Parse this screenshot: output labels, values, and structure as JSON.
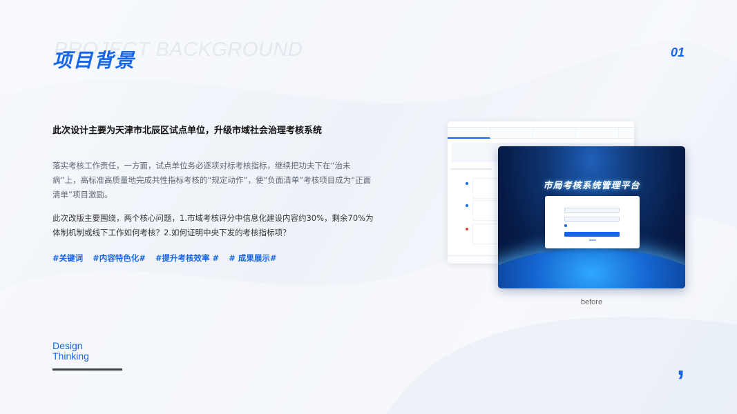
{
  "header": {
    "watermark": "PROJECT  BACKGROUND",
    "title": "项目背景",
    "page_number": "01"
  },
  "content": {
    "subtitle": "此次设计主要为天津市北辰区试点单位，升级市域社会治理考核系统",
    "paragraph1": "落实考核工作责任，一方面，试点单位务必逐项对标考核指标，继续把功夫下在“治未病”上，高标准高质量地完成共性指标考核的“规定动作”，使“负面清单”考核项目成为“正面清单”项目激励。",
    "paragraph2": "此次改版主要围绕，两个核心问题，1.市域考核评分中信息化建设内容约30%，剩余70%为体制机制或线下工作如何考核？2.如何证明中央下发的考核指标项？",
    "tags": [
      "#关键词",
      "#内容特色化#",
      "#提升考核效率 #",
      "# 成果展示#"
    ]
  },
  "footer": {
    "design_line1": "Design",
    "design_line2": "Thinking",
    "comma": ","
  },
  "screenshot": {
    "login_title": "市局考核系统管理平台",
    "caption": "before"
  },
  "colors": {
    "accent": "#1765e8",
    "dark_bar": "#3c3f48"
  }
}
